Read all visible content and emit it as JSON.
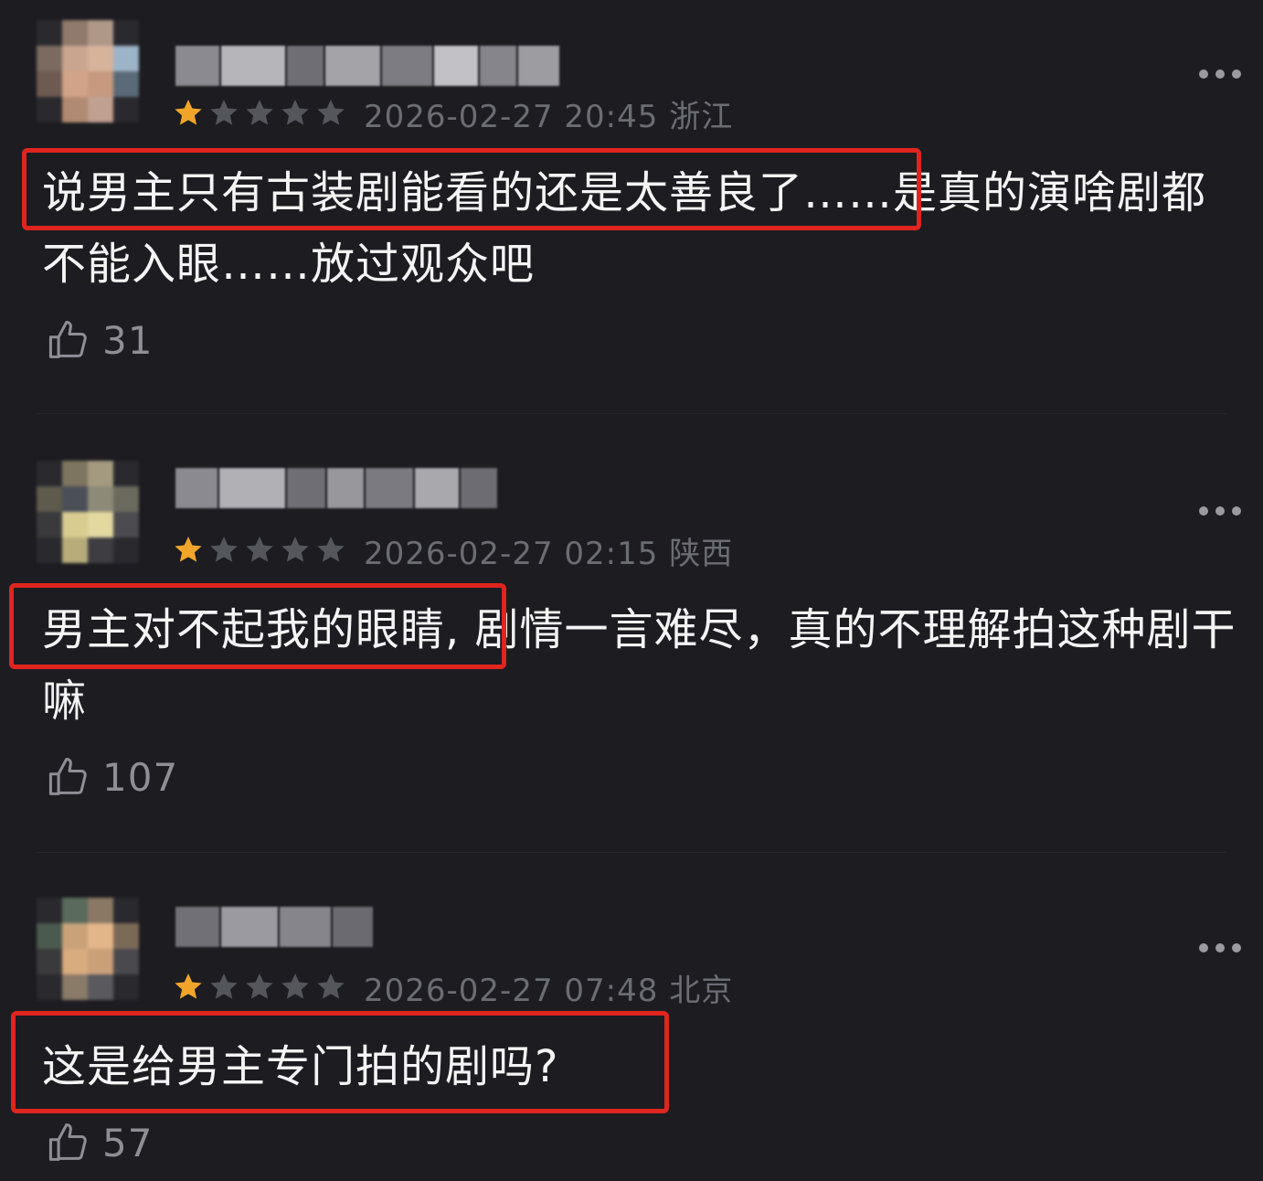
{
  "colors": {
    "background": "#1c1c21",
    "star_filled": "#f0a52a",
    "star_empty": "#55555c",
    "highlight_box": "#e0251f",
    "meta_text": "#6c6c73"
  },
  "icons": {
    "star": "star-icon",
    "more": "more-dots-icon",
    "like": "thumbs-up-icon"
  },
  "comments": [
    {
      "rating": 1,
      "rating_max": 5,
      "meta": "2026-02-27 20:45 浙江",
      "text_highlighted": "说男主只有古装剧能看的还是太善良了…",
      "text_rest": "…是真的演啥剧都不能入眼……放过观众吧",
      "likes": "31"
    },
    {
      "rating": 1,
      "rating_max": 5,
      "meta": "2026-02-27 02:15 陕西",
      "text_highlighted": "男主对不起我的眼睛,",
      "text_rest": " 剧情一言难尽，真的不理解拍这种剧干嘛",
      "likes": "107"
    },
    {
      "rating": 1,
      "rating_max": 5,
      "meta": "2026-02-27 07:48 北京",
      "text_highlighted": "这是给男主专门拍的剧吗?",
      "text_rest": "",
      "likes": "57"
    }
  ]
}
